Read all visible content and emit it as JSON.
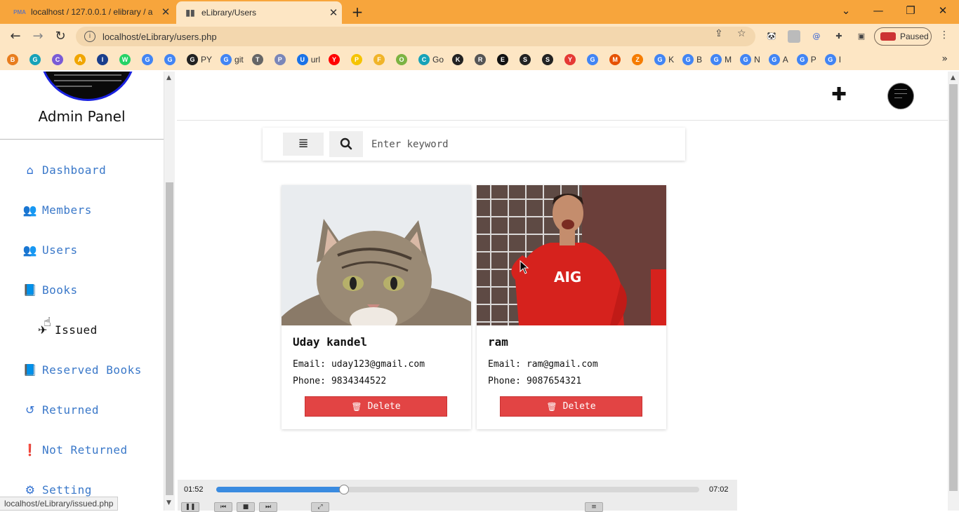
{
  "browser": {
    "tabs": [
      {
        "title": "localhost / 127.0.0.1 / elibrary / a",
        "favicon": "phpmyadmin-icon",
        "active": false
      },
      {
        "title": "eLibrary/Users",
        "favicon": "library-icon",
        "active": true
      }
    ],
    "url": "localhost/eLibrary/users.php",
    "profile_status": "Paused",
    "bookmarks": [
      {
        "label": "",
        "icon": "b"
      },
      {
        "label": "",
        "icon": "g"
      },
      {
        "label": "",
        "icon": "c"
      },
      {
        "label": "",
        "icon": "a"
      },
      {
        "label": "",
        "icon": "I"
      },
      {
        "label": "",
        "icon": "w"
      },
      {
        "label": "",
        "icon": "G"
      },
      {
        "label": "",
        "icon": "G"
      },
      {
        "label": "PY",
        "icon": "gh"
      },
      {
        "label": "git",
        "icon": "G"
      },
      {
        "label": "",
        "icon": "t"
      },
      {
        "label": "",
        "icon": "p"
      },
      {
        "label": "url",
        "icon": "u"
      },
      {
        "label": "",
        "icon": "y"
      },
      {
        "label": "",
        "icon": "P"
      },
      {
        "label": "",
        "icon": "f"
      },
      {
        "label": "",
        "icon": "o"
      },
      {
        "label": "Go",
        "icon": "c"
      },
      {
        "label": "",
        "icon": "k"
      },
      {
        "label": "",
        "icon": "r"
      },
      {
        "label": "",
        "icon": "e"
      },
      {
        "label": "",
        "icon": "s"
      },
      {
        "label": "",
        "icon": "s"
      },
      {
        "label": "",
        "icon": "Y"
      },
      {
        "label": "",
        "icon": "G"
      },
      {
        "label": "",
        "icon": "m"
      },
      {
        "label": "",
        "icon": "z"
      },
      {
        "label": "K",
        "icon": "G"
      },
      {
        "label": "B",
        "icon": "G"
      },
      {
        "label": "M",
        "icon": "G"
      },
      {
        "label": "N",
        "icon": "G"
      },
      {
        "label": "A",
        "icon": "G"
      },
      {
        "label": "P",
        "icon": "G"
      },
      {
        "label": "I",
        "icon": "G"
      }
    ],
    "status_url": "localhost/eLibrary/issued.php"
  },
  "sidebar": {
    "title": "Admin Panel",
    "items": [
      {
        "label": "Dashboard",
        "icon": "home-icon"
      },
      {
        "label": "Members",
        "icon": "users-icon"
      },
      {
        "label": "Users",
        "icon": "users-icon"
      },
      {
        "label": "Books",
        "icon": "book-icon"
      },
      {
        "label": "Issued",
        "icon": "push-pin-icon"
      },
      {
        "label": "Reserved Books",
        "icon": "book-icon"
      },
      {
        "label": "Returned",
        "icon": "undo-icon"
      },
      {
        "label": "Not Returned",
        "icon": "exclamation-icon"
      },
      {
        "label": "Setting",
        "icon": "gears-icon"
      }
    ]
  },
  "search": {
    "placeholder": "Enter keyword"
  },
  "users": [
    {
      "name": "Uday kandel",
      "email_label": "Email:",
      "email": "uday123@gmail.com",
      "phone_label": "Phone:",
      "phone": "9834344522",
      "delete_label": "Delete"
    },
    {
      "name": "ram",
      "email_label": "Email:",
      "email": "ram@gmail.com",
      "phone_label": "Phone:",
      "phone": "9087654321",
      "delete_label": "Delete"
    }
  ],
  "player": {
    "current_time": "01:52",
    "total_time": "07:02",
    "progress": 0.265
  },
  "colors": {
    "accent_blue": "#3a78c9",
    "delete_red": "#e24444",
    "tabbar_orange": "#f7a53c"
  }
}
